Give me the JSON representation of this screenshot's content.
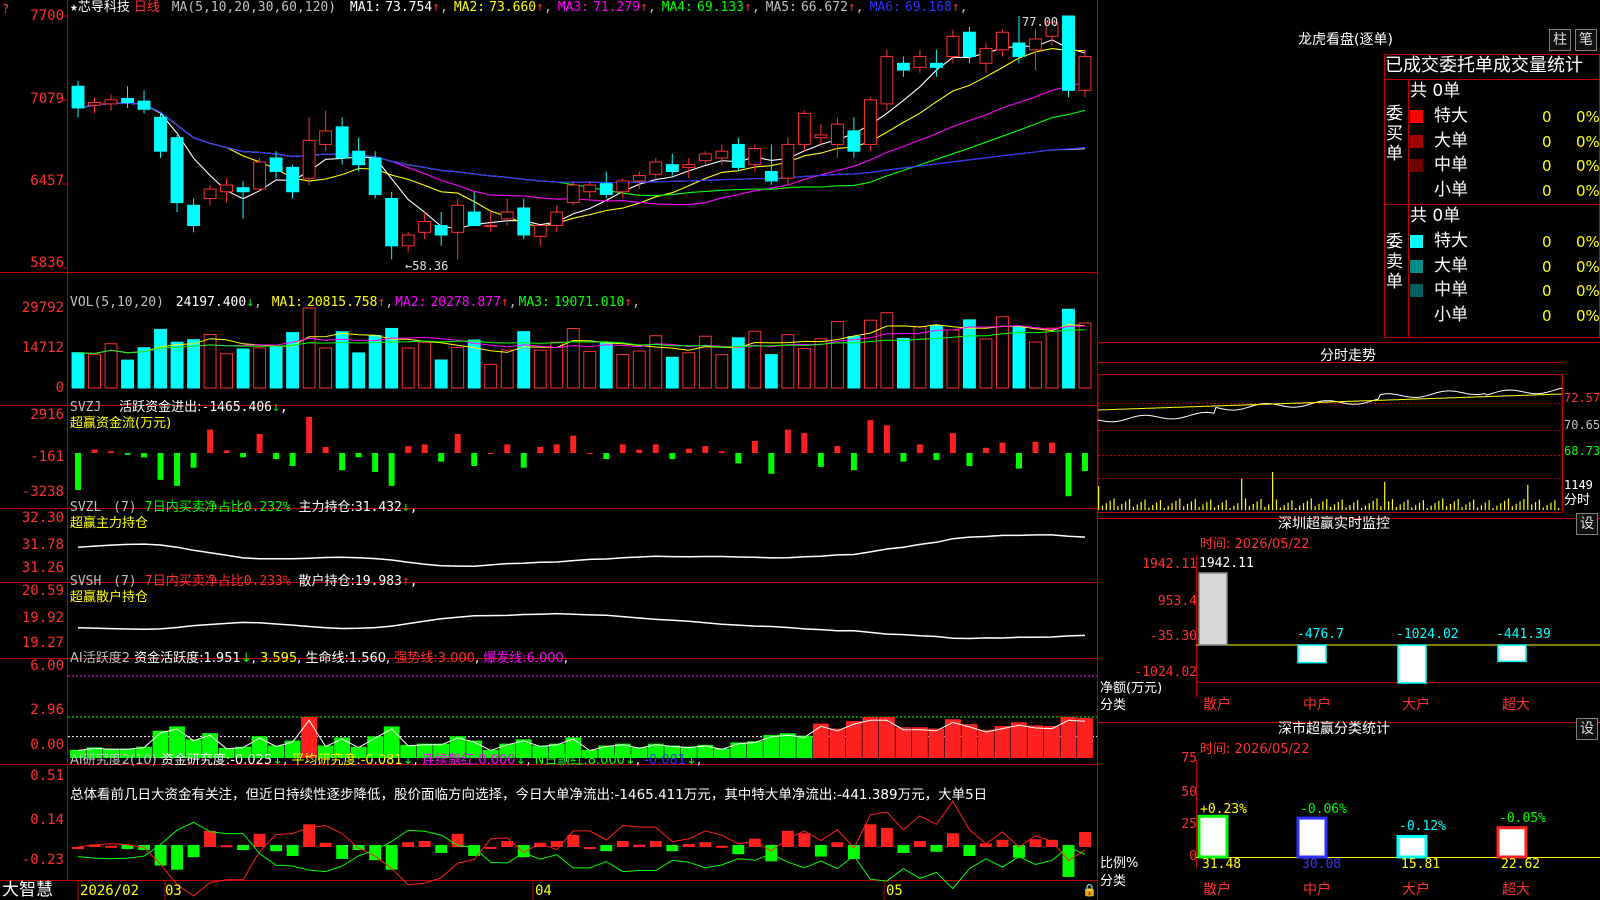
{
  "app": {
    "brand": "大智慧",
    "icon_glyph": "?"
  },
  "chart": {
    "header_star": "★",
    "stock_name": "芯导科技",
    "period_label": "日线",
    "ma_params": "MA(5,10,20,30,60,120)",
    "ma_values": [
      {
        "label": "MA1:",
        "value": "73.754",
        "arrow": "↑",
        "color": "#ffffff"
      },
      {
        "label": "MA2:",
        "value": "73.660",
        "arrow": "↑",
        "color": "#ffff00"
      },
      {
        "label": "MA3:",
        "value": "71.279",
        "arrow": "↑",
        "color": "#ff00ff"
      },
      {
        "label": "MA4:",
        "value": "69.133",
        "arrow": "↑",
        "color": "#00ff00"
      },
      {
        "label": "MA5:",
        "value": "66.672",
        "arrow": "↑",
        "color": "#c0c0c0"
      },
      {
        "label": "MA6:",
        "value": "69.168",
        "arrow": "↑",
        "color": "#3030ff"
      }
    ],
    "high_label": "77.00",
    "low_label": "←58.36",
    "price_ticks": [
      "7700",
      "7079",
      "6457",
      "5836"
    ],
    "x_labels": [
      "2026/02",
      "03",
      "04",
      "05"
    ]
  },
  "chart_data": {
    "type": "candlestick",
    "price_axis_ticks": [
      77.0,
      70.79,
      64.57,
      58.36
    ],
    "ohlc": [
      [
        71.8,
        72.2,
        69.5,
        70.2
      ],
      [
        70.4,
        71.0,
        69.8,
        70.6
      ],
      [
        70.5,
        71.2,
        70.0,
        70.8
      ],
      [
        70.9,
        71.8,
        70.2,
        70.6
      ],
      [
        70.7,
        71.5,
        69.8,
        70.1
      ],
      [
        69.5,
        69.8,
        66.5,
        67.0
      ],
      [
        68.0,
        68.2,
        62.5,
        63.2
      ],
      [
        63.0,
        63.5,
        61.0,
        61.5
      ],
      [
        63.5,
        64.5,
        63.0,
        64.2
      ],
      [
        64.0,
        65.0,
        63.2,
        64.5
      ],
      [
        64.3,
        64.8,
        62.0,
        64.0
      ],
      [
        64.2,
        66.5,
        64.0,
        66.2
      ],
      [
        66.5,
        67.0,
        65.0,
        65.5
      ],
      [
        65.8,
        66.0,
        63.5,
        64.0
      ],
      [
        65.0,
        69.5,
        64.5,
        67.8
      ],
      [
        67.5,
        70.0,
        67.0,
        68.5
      ],
      [
        68.8,
        69.5,
        66.0,
        66.5
      ],
      [
        67.0,
        68.0,
        65.5,
        66.0
      ],
      [
        66.5,
        67.0,
        63.5,
        63.8
      ],
      [
        63.5,
        64.0,
        59.0,
        60.0
      ],
      [
        60.0,
        61.0,
        59.5,
        60.8
      ],
      [
        61.0,
        62.5,
        60.5,
        61.8
      ],
      [
        61.5,
        62.5,
        60.0,
        60.8
      ],
      [
        61.0,
        63.5,
        59.0,
        63.0
      ],
      [
        62.5,
        64.0,
        61.5,
        61.5
      ],
      [
        61.5,
        62.5,
        61.0,
        61.5
      ],
      [
        62.0,
        63.5,
        61.5,
        62.5
      ],
      [
        62.8,
        63.5,
        60.5,
        60.8
      ],
      [
        60.7,
        61.5,
        60.0,
        61.5
      ],
      [
        61.5,
        63.0,
        61.0,
        62.5
      ],
      [
        63.2,
        64.8,
        63.0,
        64.5
      ],
      [
        64.0,
        64.8,
        63.5,
        64.5
      ],
      [
        64.6,
        65.5,
        63.5,
        63.8
      ],
      [
        64.0,
        65.0,
        63.5,
        64.8
      ],
      [
        64.8,
        65.5,
        64.2,
        65.2
      ],
      [
        65.3,
        66.5,
        65.0,
        66.2
      ],
      [
        66.0,
        66.8,
        65.2,
        65.5
      ],
      [
        65.8,
        66.5,
        65.0,
        66.0
      ],
      [
        66.3,
        67.0,
        66.0,
        66.8
      ],
      [
        66.5,
        67.5,
        66.0,
        67.0
      ],
      [
        67.5,
        68.0,
        65.5,
        65.8
      ],
      [
        66.0,
        67.5,
        65.5,
        67.2
      ],
      [
        65.5,
        67.5,
        64.5,
        64.8
      ],
      [
        65.0,
        68.0,
        64.5,
        67.5
      ],
      [
        67.5,
        70.0,
        67.0,
        69.8
      ],
      [
        68.0,
        69.0,
        67.5,
        68.2
      ],
      [
        67.5,
        69.5,
        66.5,
        69.0
      ],
      [
        68.5,
        69.5,
        66.5,
        67.0
      ],
      [
        67.5,
        71.0,
        67.0,
        70.8
      ],
      [
        70.5,
        74.5,
        70.0,
        74.0
      ],
      [
        73.5,
        74.0,
        72.5,
        73.0
      ],
      [
        73.2,
        74.5,
        72.8,
        74.0
      ],
      [
        73.5,
        74.5,
        72.5,
        73.2
      ],
      [
        74.0,
        76.0,
        73.5,
        75.5
      ],
      [
        75.8,
        76.2,
        73.5,
        74.0
      ],
      [
        73.5,
        75.0,
        72.8,
        74.6
      ],
      [
        74.5,
        76.0,
        74.0,
        75.8
      ],
      [
        75.0,
        77.0,
        73.5,
        74.0
      ],
      [
        74.5,
        76.0,
        73.0,
        75.3
      ],
      [
        75.5,
        76.8,
        74.8,
        76.5
      ],
      [
        77.0,
        77.0,
        71.0,
        71.5
      ],
      [
        71.5,
        74.5,
        71.0,
        74.0
      ]
    ],
    "volume_axis_ticks": [
      29792,
      14712,
      0
    ],
    "volume": {
      "title": "VOL(5,10,20)",
      "value": "24197.400",
      "arrow": "↓",
      "ma": [
        {
          "label": "MA1:",
          "value": "20815.758",
          "arrow": "↑",
          "color": "#ffff00"
        },
        {
          "label": "MA2:",
          "value": "20278.877",
          "arrow": "↑",
          "color": "#ff00ff"
        },
        {
          "label": "MA3:",
          "value": "19071.010",
          "arrow": "↑",
          "color": "#00ff00"
        }
      ]
    },
    "svzj": {
      "title": "SVZJ",
      "label": "活跃资金进出:",
      "value": "-1465.406",
      "arrow": "↓",
      "sep": ",",
      "sub": "超赢资金流(万元)",
      "ticks": [
        "2916",
        "-161",
        "-3238"
      ]
    },
    "svzl": {
      "title": "SVZL",
      "param": "(7)",
      "label": "7日内买卖净占比",
      "value": "0.232%",
      "label2": "主力持仓:",
      "value2": "31.432",
      "arrow2": "↓",
      "sep": ",",
      "sub": "超赢主力持仓",
      "ticks": [
        "32.30",
        "31.78",
        "31.26"
      ]
    },
    "svsh": {
      "title": "SVSH",
      "param": "(7)",
      "label": "7日内买卖净占比",
      "value": "0.233%",
      "label2": "散户持仓:",
      "value2": "19.983",
      "arrow2": "↑",
      "sep": ",",
      "sub": "超赢散户持仓",
      "ticks": [
        "20.59",
        "19.92",
        "19.27"
      ]
    },
    "ai_activity": {
      "title": "AI活跃度2",
      "label": "资金活跃度:",
      "value": "1.951",
      "arrow": "↓",
      "sep": ",",
      "value_b": "3.595",
      "label_c": "生命线:",
      "value_c": "1.560",
      "label_d": "强势线:",
      "value_d": "3.000",
      "label_e": "爆发线:",
      "value_e": "6.000",
      "ticks": [
        "6.00",
        "2.96",
        "0.00"
      ]
    },
    "ai_research": {
      "title": "AI研究度2(10)",
      "label": "资金研究度:",
      "value": "-0.025",
      "arrow": "↓",
      "label_b": "平均研究度:",
      "value_b": "-0.081",
      "arrow_b": "↓",
      "label_c": "连续飘红:",
      "value_c": "0.000",
      "arrow_c": "↓",
      "label_d": "N日飘红:",
      "value_d": "8.000",
      "arrow_d": "↓",
      "value_e": "-0.081",
      "arrow_e": "↓",
      "sep": ",",
      "ticks": [
        "0.51",
        "0.14",
        "-0.23"
      ],
      "comment": "总体看前几日大资金有关注，但近日持续性逐步降低，股价面临方向选择，今日大单净流出:-1465.411万元，其中特大单净流出:-441.389万元，大单5日"
    }
  },
  "dragon": {
    "title": "龙虎看盘(逐单)",
    "btn_bar": "柱",
    "btn_pen": "笔",
    "header": "已成交委托单成交量统计",
    "buy": {
      "label": "委买单",
      "total": "共 0单",
      "rows": [
        {
          "name": "特大",
          "count": "0",
          "pct": "0%",
          "color": "#ff0000"
        },
        {
          "name": "大单",
          "count": "0",
          "pct": "0%",
          "color": "#a00000"
        },
        {
          "name": "中单",
          "count": "0",
          "pct": "0%",
          "color": "#700000"
        },
        {
          "name": "小单",
          "count": "0",
          "pct": "0%",
          "color": ""
        }
      ]
    },
    "sell": {
      "label": "委卖单",
      "total": "共 0单",
      "rows": [
        {
          "name": "特大",
          "count": "0",
          "pct": "0%",
          "color": "#00ffff"
        },
        {
          "name": "大单",
          "count": "0",
          "pct": "0%",
          "color": "#008c8c"
        },
        {
          "name": "中单",
          "count": "0",
          "pct": "0%",
          "color": "#006060"
        },
        {
          "name": "小单",
          "count": "0",
          "pct": "0%",
          "color": ""
        }
      ]
    }
  },
  "intraday": {
    "title": "分时走势",
    "price_ticks": [
      "72.57",
      "70.65",
      "68.73"
    ],
    "vol_tick": "1149",
    "vol_label": "分时"
  },
  "sz_monitor": {
    "title": "深圳超赢实时监控",
    "btn": "设",
    "date_label": "时间:",
    "date": "2026/05/22",
    "axis_ticks": [
      "1942.11",
      "953.4",
      "-35.30",
      "-1024.02"
    ],
    "unit_label": "净额(万元)",
    "cat_label": "分类",
    "bars": [
      {
        "name": "散户",
        "value": 1942.11,
        "label": "1942.11"
      },
      {
        "name": "中户",
        "value": -476.7,
        "label": "-476.7"
      },
      {
        "name": "大户",
        "value": -1024.02,
        "label": "-1024.02"
      },
      {
        "name": "超大",
        "value": -441.39,
        "label": "-441.39"
      }
    ]
  },
  "sz_stats": {
    "title": "深市超赢分类统计",
    "btn": "设",
    "date_label": "时间:",
    "date": "2026/05/22",
    "axis_ticks": [
      "75",
      "50",
      "25",
      "0"
    ],
    "unit_label": "比例%",
    "cat_label": "分类",
    "bars": [
      {
        "name": "散户",
        "value": 31.48,
        "label": "31.48",
        "change": "+0.23%",
        "color": "#00ff00"
      },
      {
        "name": "中户",
        "value": 30.08,
        "label": "30.08",
        "change": "-0.06%",
        "color": "#3030ff"
      },
      {
        "name": "大户",
        "value": 15.81,
        "label": "15.81",
        "change": "-0.12%",
        "color": "#00ffff"
      },
      {
        "name": "超大",
        "value": 22.62,
        "label": "22.62",
        "change": "-0.05%",
        "color": "#ff2020"
      }
    ]
  }
}
